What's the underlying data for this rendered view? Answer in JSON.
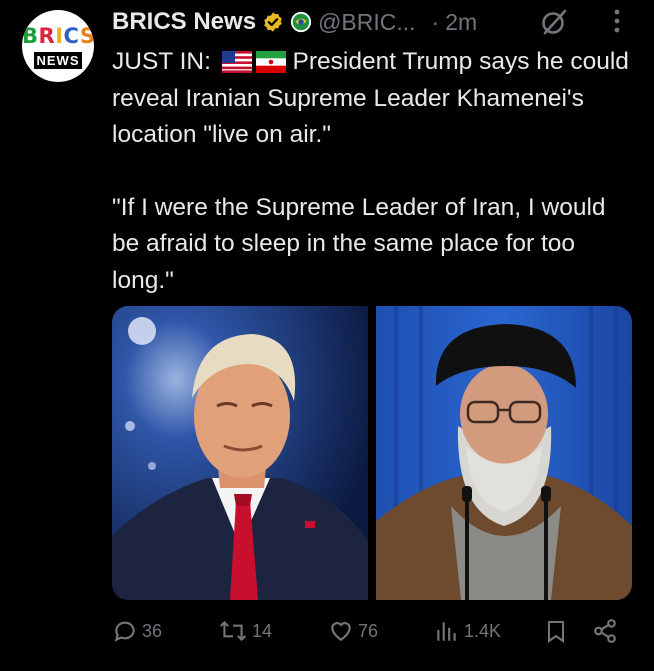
{
  "author": {
    "name": "BRICS News",
    "handle": "@BRIC...",
    "time": "2m",
    "avatar_text_top": "BRICS",
    "avatar_text_bottom": "NEWS"
  },
  "tweet": {
    "lead": "JUST IN:",
    "line1_rest": "President Trump says he could reveal Iranian Supreme Leader Khamenei's location \"live on air.\"",
    "quote": "\"If I were the Supreme Leader of Iran, I would be afraid to sleep in the same place for too long.\""
  },
  "media": {
    "left_image": "photo-trump",
    "right_image": "photo-khamenei"
  },
  "actions": {
    "replies": "36",
    "reposts": "14",
    "likes": "76",
    "views": "1.4K"
  },
  "icons": {
    "verified": "gold-verified-badge",
    "affiliate": "green-affiliate-badge",
    "grok": "grok-icon",
    "more": "more-icon",
    "reply": "reply-icon",
    "repost": "repost-icon",
    "like": "like-icon",
    "views": "views-icon",
    "bookmark": "bookmark-icon",
    "share": "share-icon"
  },
  "colors": {
    "background": "#000000",
    "text": "#e7e9ea",
    "muted": "#71767b",
    "gold": "#e8b923"
  }
}
